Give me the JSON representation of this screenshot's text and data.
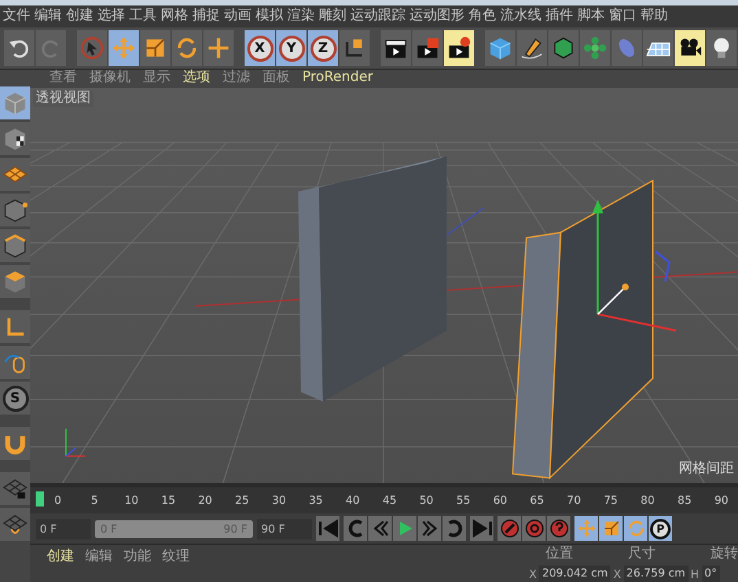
{
  "menu_bar": [
    "文件",
    "编辑",
    "创建",
    "选择",
    "工具",
    "网格",
    "捕捉",
    "动画",
    "模拟",
    "渲染",
    "雕刻",
    "运动跟踪",
    "运动图形",
    "角色",
    "流水线",
    "插件",
    "脚本",
    "窗口",
    "帮助"
  ],
  "toolbar": [
    {
      "kind": "undo",
      "selected": false
    },
    {
      "kind": "redo",
      "selected": false
    },
    {
      "kind": "select",
      "selected": false
    },
    {
      "kind": "move",
      "selected": true
    },
    {
      "kind": "scale",
      "selected": false
    },
    {
      "kind": "rotate",
      "selected": false
    },
    {
      "kind": "add",
      "selected": false
    },
    {
      "kind": "axis",
      "label": "X",
      "selected": true
    },
    {
      "kind": "axis",
      "label": "Y",
      "selected": true
    },
    {
      "kind": "axis",
      "label": "Z",
      "selected": true
    },
    {
      "kind": "coord",
      "selected": false
    },
    {
      "kind": "render-view",
      "selected": false
    },
    {
      "kind": "render-picture",
      "selected": false
    },
    {
      "kind": "render-settings",
      "selected": true
    },
    {
      "kind": "cube",
      "selected": false
    },
    {
      "kind": "pen",
      "selected": false
    },
    {
      "kind": "subdivide",
      "selected": false
    },
    {
      "kind": "array",
      "selected": false
    },
    {
      "kind": "deformer",
      "selected": false
    },
    {
      "kind": "floor",
      "selected": false
    },
    {
      "kind": "camera",
      "selected": true
    },
    {
      "kind": "light",
      "selected": false
    }
  ],
  "side_toolbar": [
    {
      "kind": "model",
      "selected": true
    },
    {
      "kind": "texture",
      "selected": false
    },
    {
      "kind": "tiles",
      "selected": false
    },
    {
      "kind": "points",
      "selected": false
    },
    {
      "kind": "edges",
      "selected": false
    },
    {
      "kind": "polygons",
      "selected": false
    },
    {
      "kind": "axis-tool",
      "selected": false
    },
    {
      "kind": "tweak",
      "selected": false
    },
    {
      "kind": "solo",
      "label": "S",
      "selected": false
    },
    {
      "kind": "magnet",
      "selected": false
    },
    {
      "kind": "workplane-lock",
      "selected": false
    },
    {
      "kind": "workplane",
      "selected": false
    }
  ],
  "viewport": {
    "menu": [
      {
        "label": "查看",
        "selected": false
      },
      {
        "label": "摄像机",
        "selected": false
      },
      {
        "label": "显示",
        "selected": false
      },
      {
        "label": "选项",
        "selected": true
      },
      {
        "label": "过滤",
        "selected": false
      },
      {
        "label": "面板",
        "selected": false
      },
      {
        "label": "ProRender",
        "selected": true
      }
    ],
    "label": "透视视图",
    "grid_note": "网格间距"
  },
  "timeline": {
    "ticks": [
      "0",
      "5",
      "10",
      "15",
      "20",
      "25",
      "30",
      "35",
      "40",
      "45",
      "50",
      "55",
      "60",
      "65",
      "70",
      "75",
      "80",
      "85",
      "90"
    ]
  },
  "transport": {
    "start_field": "0 F",
    "range": {
      "level": 1,
      "start": "0 F",
      "end": "90 F"
    },
    "end_field": "90 F"
  },
  "key_tools": [
    {
      "kind": "move",
      "selected": true
    },
    {
      "kind": "scale",
      "selected": true
    },
    {
      "kind": "rotate",
      "selected": true
    },
    {
      "kind": "param",
      "label": "P",
      "selected": true
    }
  ],
  "bottom_tabs": [
    {
      "label": "创建",
      "selected": true
    },
    {
      "label": "编辑",
      "selected": false
    },
    {
      "label": "功能",
      "selected": false
    },
    {
      "label": "纹理",
      "selected": false
    }
  ],
  "coordinates": {
    "headers": [
      "位置",
      "尺寸",
      "旋转"
    ],
    "fields": [
      {
        "axis": "X",
        "value": "209.042 cm"
      },
      {
        "axis": "X",
        "value": "26.759 cm"
      },
      {
        "axis": "H",
        "value": "0°"
      }
    ]
  }
}
